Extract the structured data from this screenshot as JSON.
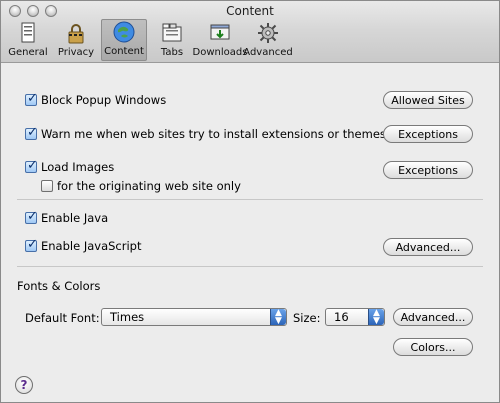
{
  "window": {
    "title": "Content"
  },
  "toolbar": {
    "items": [
      {
        "label": "General",
        "icon": "general-icon"
      },
      {
        "label": "Privacy",
        "icon": "privacy-icon"
      },
      {
        "label": "Content",
        "icon": "content-icon",
        "selected": true
      },
      {
        "label": "Tabs",
        "icon": "tabs-icon"
      },
      {
        "label": "Downloads",
        "icon": "downloads-icon"
      },
      {
        "label": "Advanced",
        "icon": "advanced-icon"
      }
    ]
  },
  "options": {
    "block_popups": {
      "label": "Block Popup Windows",
      "checked": true,
      "button": "Allowed Sites"
    },
    "warn_extensions": {
      "label": "Warn me when web sites try to install extensions or themes",
      "checked": true,
      "button": "Exceptions"
    },
    "load_images": {
      "label": "Load Images",
      "checked": true,
      "button": "Exceptions"
    },
    "originating_only": {
      "label": "for the originating web site only",
      "checked": false
    },
    "enable_java": {
      "label": "Enable Java",
      "checked": true
    },
    "enable_javascript": {
      "label": "Enable JavaScript",
      "checked": true,
      "button": "Advanced..."
    }
  },
  "fonts": {
    "section_title": "Fonts & Colors",
    "default_font_label": "Default Font:",
    "default_font_value": "Times",
    "size_label": "Size:",
    "size_value": "16",
    "advanced_button": "Advanced...",
    "colors_button": "Colors..."
  },
  "help": {
    "label": "?"
  }
}
